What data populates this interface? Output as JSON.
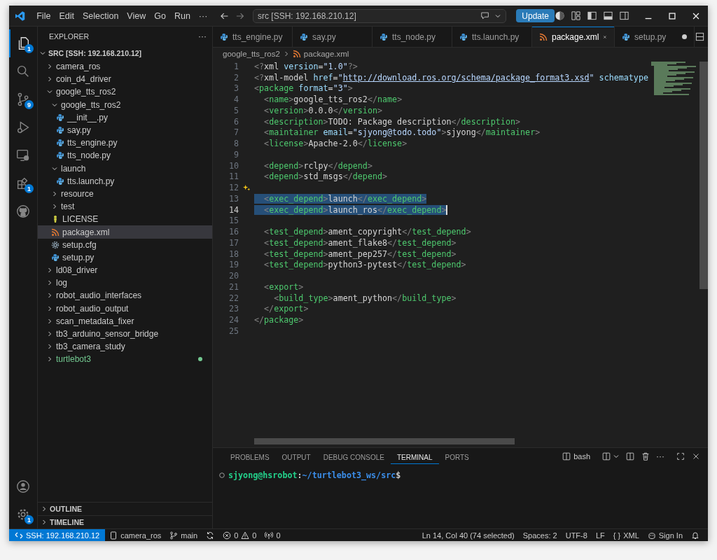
{
  "titlebar": {
    "menus": [
      "File",
      "Edit",
      "Selection",
      "View",
      "Go",
      "Run"
    ],
    "more": "···",
    "command_center": "src [SSH: 192.168.210.12]",
    "update_button": "Update"
  },
  "activity_bar": [
    {
      "kind": "explorer",
      "badge": "1",
      "selected": true
    },
    {
      "kind": "search",
      "selected": false
    },
    {
      "kind": "source-control",
      "badge": "9",
      "selected": false
    },
    {
      "kind": "run-debug",
      "selected": false
    },
    {
      "kind": "remote",
      "selected": false
    },
    {
      "kind": "extensions",
      "badge": "1",
      "selected": false
    },
    {
      "kind": "github",
      "selected": false
    }
  ],
  "activity_bottom": [
    {
      "kind": "account"
    },
    {
      "kind": "settings",
      "badge": "1"
    }
  ],
  "explorer": {
    "title": "EXPLORER",
    "more": "···",
    "root": "SRC [SSH: 192.168.210.12]",
    "tree": [
      {
        "label": "camera_ros",
        "kind": "folder",
        "expanded": false,
        "selected": false
      },
      {
        "label": "coin_d4_driver",
        "kind": "folder",
        "expanded": false,
        "selected": false
      },
      {
        "label": "google_tts_ros2",
        "kind": "folder",
        "expanded": true,
        "selected": false,
        "children": [
          {
            "label": "google_tts_ros2",
            "kind": "folder",
            "expanded": true,
            "selected": false,
            "children": [
              {
                "label": "__init__.py",
                "kind": "python",
                "selected": false
              },
              {
                "label": "say.py",
                "kind": "python",
                "selected": false
              },
              {
                "label": "tts_engine.py",
                "kind": "python",
                "selected": false
              },
              {
                "label": "tts_node.py",
                "kind": "python",
                "selected": false
              }
            ]
          },
          {
            "label": "launch",
            "kind": "folder",
            "expanded": true,
            "selected": false,
            "children": [
              {
                "label": "tts.launch.py",
                "kind": "python",
                "selected": false
              }
            ]
          },
          {
            "label": "resource",
            "kind": "folder",
            "expanded": false,
            "selected": false
          },
          {
            "label": "test",
            "kind": "folder",
            "expanded": false,
            "selected": false
          },
          {
            "label": "LICENSE",
            "kind": "license",
            "selected": false
          },
          {
            "label": "package.xml",
            "kind": "xml",
            "selected": true
          },
          {
            "label": "setup.cfg",
            "kind": "config",
            "selected": false
          },
          {
            "label": "setup.py",
            "kind": "python",
            "selected": false
          }
        ]
      },
      {
        "label": "ld08_driver",
        "kind": "folder",
        "expanded": false,
        "selected": false
      },
      {
        "label": "log",
        "kind": "folder",
        "expanded": false,
        "selected": false
      },
      {
        "label": "robot_audio_interfaces",
        "kind": "folder",
        "expanded": false,
        "selected": false
      },
      {
        "label": "robot_audio_output",
        "kind": "folder",
        "expanded": false,
        "selected": false
      },
      {
        "label": "scan_metadata_fixer",
        "kind": "folder",
        "expanded": false,
        "selected": false
      },
      {
        "label": "tb3_arduino_sensor_bridge",
        "kind": "folder",
        "expanded": false,
        "selected": false
      },
      {
        "label": "tb3_camera_study",
        "kind": "folder",
        "expanded": false,
        "selected": false
      },
      {
        "label": "turtlebot3",
        "kind": "folder",
        "expanded": false,
        "selected": false,
        "modified": true
      }
    ],
    "sections": [
      "OUTLINE",
      "TIMELINE"
    ]
  },
  "tabs": [
    {
      "label": "tts_engine.py",
      "kind": "python",
      "selected": false,
      "modified": false
    },
    {
      "label": "say.py",
      "kind": "python",
      "selected": false,
      "modified": false
    },
    {
      "label": "tts_node.py",
      "kind": "python",
      "selected": false,
      "modified": false
    },
    {
      "label": "tts.launch.py",
      "kind": "python",
      "selected": false,
      "modified": false
    },
    {
      "label": "package.xml",
      "kind": "xml",
      "selected": true,
      "modified": false
    },
    {
      "label": "setup.py",
      "kind": "python",
      "selected": false,
      "modified": true
    }
  ],
  "breadcrumb": [
    "google_tts_ros2",
    "package.xml"
  ],
  "code": [
    {
      "n": "1",
      "selected": false,
      "tokens": [
        {
          "kind": "p",
          "text": "<?"
        },
        {
          "kind": "text",
          "text": "xml"
        },
        {
          "kind": "attr",
          "text": " version"
        },
        {
          "kind": "text",
          "text": "="
        },
        {
          "kind": "str",
          "text": "\"1.0\""
        },
        {
          "kind": "p",
          "text": "?>"
        }
      ]
    },
    {
      "n": "2",
      "selected": false,
      "tokens": [
        {
          "kind": "p",
          "text": "<?"
        },
        {
          "kind": "text",
          "text": "xml-model"
        },
        {
          "kind": "attr",
          "text": " href"
        },
        {
          "kind": "text",
          "text": "="
        },
        {
          "kind": "str",
          "text": "\""
        },
        {
          "kind": "link",
          "text": "http://download.ros.org/schema/package_format3.xsd"
        },
        {
          "kind": "str",
          "text": "\""
        },
        {
          "kind": "attr",
          "text": " schematype"
        }
      ]
    },
    {
      "n": "3",
      "selected": false,
      "tokens": [
        {
          "kind": "p",
          "text": "<"
        },
        {
          "kind": "tag",
          "text": "package"
        },
        {
          "kind": "attr",
          "text": " format"
        },
        {
          "kind": "text",
          "text": "="
        },
        {
          "kind": "str",
          "text": "\"3\""
        },
        {
          "kind": "p",
          "text": ">"
        }
      ]
    },
    {
      "n": "4",
      "selected": false,
      "tokens": [
        {
          "kind": "p",
          "text": "  <"
        },
        {
          "kind": "tag",
          "text": "name"
        },
        {
          "kind": "p",
          "text": ">"
        },
        {
          "kind": "text",
          "text": "google_tts_ros2"
        },
        {
          "kind": "p",
          "text": "</"
        },
        {
          "kind": "tag",
          "text": "name"
        },
        {
          "kind": "p",
          "text": ">"
        }
      ]
    },
    {
      "n": "5",
      "selected": false,
      "tokens": [
        {
          "kind": "p",
          "text": "  <"
        },
        {
          "kind": "tag",
          "text": "version"
        },
        {
          "kind": "p",
          "text": ">"
        },
        {
          "kind": "text",
          "text": "0.0.0"
        },
        {
          "kind": "p",
          "text": "</"
        },
        {
          "kind": "tag",
          "text": "version"
        },
        {
          "kind": "p",
          "text": ">"
        }
      ]
    },
    {
      "n": "6",
      "selected": false,
      "tokens": [
        {
          "kind": "p",
          "text": "  <"
        },
        {
          "kind": "tag",
          "text": "description"
        },
        {
          "kind": "p",
          "text": ">"
        },
        {
          "kind": "text",
          "text": "TODO: Package description"
        },
        {
          "kind": "p",
          "text": "</"
        },
        {
          "kind": "tag",
          "text": "description"
        },
        {
          "kind": "p",
          "text": ">"
        }
      ]
    },
    {
      "n": "7",
      "selected": false,
      "tokens": [
        {
          "kind": "p",
          "text": "  <"
        },
        {
          "kind": "tag",
          "text": "maintainer"
        },
        {
          "kind": "attr",
          "text": " email"
        },
        {
          "kind": "text",
          "text": "="
        },
        {
          "kind": "str",
          "text": "\"sjyong@todo.todo\""
        },
        {
          "kind": "p",
          "text": ">"
        },
        {
          "kind": "text",
          "text": "sjyong"
        },
        {
          "kind": "p",
          "text": "</"
        },
        {
          "kind": "tag",
          "text": "maintainer"
        },
        {
          "kind": "p",
          "text": ">"
        }
      ]
    },
    {
      "n": "8",
      "selected": false,
      "tokens": [
        {
          "kind": "p",
          "text": "  <"
        },
        {
          "kind": "tag",
          "text": "license"
        },
        {
          "kind": "p",
          "text": ">"
        },
        {
          "kind": "text",
          "text": "Apache-2.0"
        },
        {
          "kind": "p",
          "text": "</"
        },
        {
          "kind": "tag",
          "text": "license"
        },
        {
          "kind": "p",
          "text": ">"
        }
      ]
    },
    {
      "n": "9"
    },
    {
      "n": "10",
      "selected": false,
      "tokens": [
        {
          "kind": "p",
          "text": "  <"
        },
        {
          "kind": "tag",
          "text": "depend"
        },
        {
          "kind": "p",
          "text": ">"
        },
        {
          "kind": "text",
          "text": "rclpy"
        },
        {
          "kind": "p",
          "text": "</"
        },
        {
          "kind": "tag",
          "text": "depend"
        },
        {
          "kind": "p",
          "text": ">"
        }
      ]
    },
    {
      "n": "11",
      "selected": false,
      "tokens": [
        {
          "kind": "p",
          "text": "  <"
        },
        {
          "kind": "tag",
          "text": "depend"
        },
        {
          "kind": "p",
          "text": ">"
        },
        {
          "kind": "text",
          "text": "std_msgs"
        },
        {
          "kind": "p",
          "text": "</"
        },
        {
          "kind": "tag",
          "text": "depend"
        },
        {
          "kind": "p",
          "text": ">"
        }
      ]
    },
    {
      "n": "12",
      "sparkle": true
    },
    {
      "n": "13",
      "selected": true,
      "tokens": [
        {
          "kind": "p",
          "text": "  <"
        },
        {
          "kind": "tag",
          "text": "exec_depend"
        },
        {
          "kind": "p",
          "text": ">"
        },
        {
          "kind": "text",
          "text": "launch"
        },
        {
          "kind": "p",
          "text": "</"
        },
        {
          "kind": "tag",
          "text": "exec_depend"
        },
        {
          "kind": "p",
          "text": ">"
        }
      ]
    },
    {
      "n": "14",
      "selected": true,
      "cursor": true,
      "tokens": [
        {
          "kind": "p",
          "text": "  <"
        },
        {
          "kind": "tag",
          "text": "exec_depend"
        },
        {
          "kind": "p",
          "text": ">"
        },
        {
          "kind": "text",
          "text": "launch_ros"
        },
        {
          "kind": "p",
          "text": "</"
        },
        {
          "kind": "tag",
          "text": "exec_depend"
        },
        {
          "kind": "p",
          "text": ">"
        }
      ]
    },
    {
      "n": "15"
    },
    {
      "n": "16",
      "selected": false,
      "tokens": [
        {
          "kind": "p",
          "text": "  <"
        },
        {
          "kind": "tag",
          "text": "test_depend"
        },
        {
          "kind": "p",
          "text": ">"
        },
        {
          "kind": "text",
          "text": "ament_copyright"
        },
        {
          "kind": "p",
          "text": "</"
        },
        {
          "kind": "tag",
          "text": "test_depend"
        },
        {
          "kind": "p",
          "text": ">"
        }
      ]
    },
    {
      "n": "17",
      "selected": false,
      "tokens": [
        {
          "kind": "p",
          "text": "  <"
        },
        {
          "kind": "tag",
          "text": "test_depend"
        },
        {
          "kind": "p",
          "text": ">"
        },
        {
          "kind": "text",
          "text": "ament_flake8"
        },
        {
          "kind": "p",
          "text": "</"
        },
        {
          "kind": "tag",
          "text": "test_depend"
        },
        {
          "kind": "p",
          "text": ">"
        }
      ]
    },
    {
      "n": "18",
      "selected": false,
      "tokens": [
        {
          "kind": "p",
          "text": "  <"
        },
        {
          "kind": "tag",
          "text": "test_depend"
        },
        {
          "kind": "p",
          "text": ">"
        },
        {
          "kind": "text",
          "text": "ament_pep257"
        },
        {
          "kind": "p",
          "text": "</"
        },
        {
          "kind": "tag",
          "text": "test_depend"
        },
        {
          "kind": "p",
          "text": ">"
        }
      ]
    },
    {
      "n": "19",
      "selected": false,
      "tokens": [
        {
          "kind": "p",
          "text": "  <"
        },
        {
          "kind": "tag",
          "text": "test_depend"
        },
        {
          "kind": "p",
          "text": ">"
        },
        {
          "kind": "text",
          "text": "python3-pytest"
        },
        {
          "kind": "p",
          "text": "</"
        },
        {
          "kind": "tag",
          "text": "test_depend"
        },
        {
          "kind": "p",
          "text": ">"
        }
      ]
    },
    {
      "n": "20"
    },
    {
      "n": "21",
      "selected": false,
      "tokens": [
        {
          "kind": "p",
          "text": "  <"
        },
        {
          "kind": "tag",
          "text": "export"
        },
        {
          "kind": "p",
          "text": ">"
        }
      ]
    },
    {
      "n": "22",
      "selected": false,
      "tokens": [
        {
          "kind": "p",
          "text": "    <"
        },
        {
          "kind": "tag",
          "text": "build_type"
        },
        {
          "kind": "p",
          "text": ">"
        },
        {
          "kind": "text",
          "text": "ament_python"
        },
        {
          "kind": "p",
          "text": "</"
        },
        {
          "kind": "tag",
          "text": "build_type"
        },
        {
          "kind": "p",
          "text": ">"
        }
      ]
    },
    {
      "n": "23",
      "selected": false,
      "tokens": [
        {
          "kind": "p",
          "text": "  </"
        },
        {
          "kind": "tag",
          "text": "export"
        },
        {
          "kind": "p",
          "text": ">"
        }
      ]
    },
    {
      "n": "24",
      "selected": false,
      "tokens": [
        {
          "kind": "p",
          "text": "</"
        },
        {
          "kind": "tag",
          "text": "package"
        },
        {
          "kind": "p",
          "text": ">"
        }
      ]
    },
    {
      "n": "25"
    }
  ],
  "panel": {
    "tabs": [
      {
        "label": "PROBLEMS",
        "selected": false
      },
      {
        "label": "OUTPUT",
        "selected": false
      },
      {
        "label": "DEBUG CONSOLE",
        "selected": false
      },
      {
        "label": "TERMINAL",
        "selected": true
      },
      {
        "label": "PORTS",
        "selected": false
      }
    ],
    "shell": "bash",
    "prompt": [
      {
        "kind": "user",
        "text": "sjyong@hsrobot"
      },
      {
        "kind": "plain",
        "text": ":"
      },
      {
        "kind": "path",
        "text": "~/turtlebot3_ws/src"
      },
      {
        "kind": "plain",
        "text": "$"
      }
    ]
  },
  "status_bar": {
    "left": [
      {
        "kind": "remote",
        "label": "SSH: 192.168.210.12"
      },
      {
        "kind": "device",
        "label": "camera_ros"
      },
      {
        "kind": "branch",
        "label": "main"
      },
      {
        "kind": "sync"
      },
      {
        "kind": "problems",
        "errors": "0",
        "warnings": "0"
      },
      {
        "kind": "ports",
        "label": "0"
      }
    ],
    "right": [
      {
        "kind": "text",
        "label": "Ln 14, Col 40 (74 selected)"
      },
      {
        "kind": "text",
        "label": "Spaces: 2"
      },
      {
        "kind": "text",
        "label": "UTF-8"
      },
      {
        "kind": "text",
        "label": "LF"
      },
      {
        "kind": "language",
        "icon": "{ }",
        "label": "XML"
      },
      {
        "kind": "account",
        "label": "Sign In"
      },
      {
        "kind": "bell"
      }
    ]
  }
}
